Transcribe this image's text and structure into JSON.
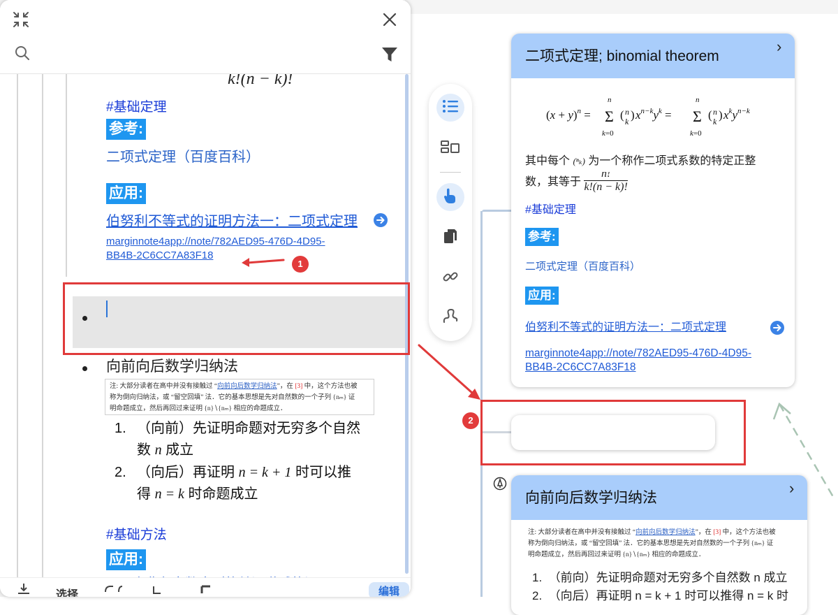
{
  "outline": {
    "formula_partial": "k!(n − k)!",
    "tag1": "#基础定理",
    "ref_label": "参考:",
    "ref_link": "二项式定理（百度百科）",
    "app_label": "应用:",
    "app_link": "伯努利不等式的证明方法一：二项式定理",
    "url_line1": "marginnote4app://note/782AED95-476D-4D95-",
    "url_line2": "BB4B-2C6CC7A83F18",
    "item2_title": "向前向后数学归纳法",
    "note_line1_a": "注:   大部分读者在高中并没有接触过 “",
    "note_line1_link": "向前向后数学归纳法",
    "note_line1_b": "”，在 ",
    "note_line1_ref": "[3]",
    "note_line1_c": " 中，这个方法也被",
    "note_line2": "称为倒向归纳法，或 “留空回填” 法．它的基本思想是先对自然数的一个子列 {nₘ} 证",
    "note_line3": "明命题成立，然后再回过来证明 {n}∖{nₘ} 相应的命题成立．",
    "list1_num": "1.",
    "list1_line1": "（向前）先证明命题对无穷多个自然",
    "list1_line2_a": "数 ",
    "list1_line2_var": "n",
    "list1_line2_b": " 成立",
    "list2_num": "2.",
    "list2_line1_a": "（向后）再证明 ",
    "list2_line1_math": "n = k + 1",
    "list2_line1_b": " 时可以推",
    "list2_line2_a": "得 ",
    "list2_line2_math": "n = k",
    "list2_line2_b": " 时命题成立",
    "tag2": "#基础方法",
    "app_label2": "应用:",
    "partial_bottom": "一个非负实数序列的单调递减的证明"
  },
  "bottom_bar": {
    "select": "选择",
    "edit": "编辑"
  },
  "card1": {
    "title": "二项式定理; binomial theorem",
    "formula": "(x + y)ⁿ = Σ (n k) xⁿ⁻ᵏ yᵏ = Σ (n k) xᵏ yⁿ⁻ᵏ",
    "desc_a": "其中每个 ",
    "desc_b": " 为一个称作二项式系数的特定正整",
    "desc_c": "数，其等于 ",
    "frac_num": "n!",
    "frac_den": "k!(n − k)!",
    "tag": "#基础定理",
    "ref_label": "参考:",
    "ref_link": "二项式定理（百度百科）",
    "app_label": "应用:",
    "app_link": "伯努利不等式的证明方法一：二项式定理",
    "url_line1": "marginnote4app://note/782AED95-476D-4D95-",
    "url_line2": "BB4B-2C6CC7A83F18"
  },
  "card2": {
    "title": "向前向后数学归纳法",
    "list1": "（前向）先证明命题对无穷多个自然数 n 成立",
    "list2": "（向后）再证明 n = k + 1 时可以推得 n = k 时"
  },
  "annotations": {
    "badge1": "1",
    "badge2": "2"
  },
  "colors": {
    "accent": "#1e96f0",
    "card_header": "#a9cdfb",
    "annotation_red": "#e03a3a"
  }
}
